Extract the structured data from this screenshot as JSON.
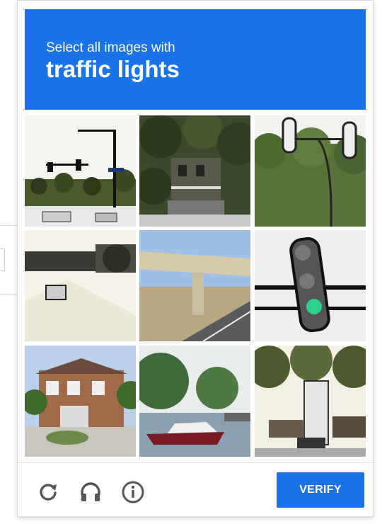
{
  "challenge": {
    "lead": "Select all images with",
    "target": "traffic lights"
  },
  "tiles": [
    {
      "index": 1,
      "content": "road-with-overhead-traffic-signal"
    },
    {
      "index": 2,
      "content": "trees-and-building"
    },
    {
      "index": 3,
      "content": "traffic-lights-over-trees"
    },
    {
      "index": 4,
      "content": "car-under-overpass"
    },
    {
      "index": 5,
      "content": "highway-overpass"
    },
    {
      "index": 6,
      "content": "close-up-traffic-light"
    },
    {
      "index": 7,
      "content": "brick-house"
    },
    {
      "index": 8,
      "content": "boat-on-water"
    },
    {
      "index": 9,
      "content": "street-with-building"
    }
  ],
  "toolbar": {
    "reload_icon": "reload-icon",
    "audio_icon": "headphones-icon",
    "info_icon": "info-icon",
    "verify_label": "VERIFY"
  },
  "colors": {
    "accent": "#1a73e8",
    "icon": "#555555"
  }
}
